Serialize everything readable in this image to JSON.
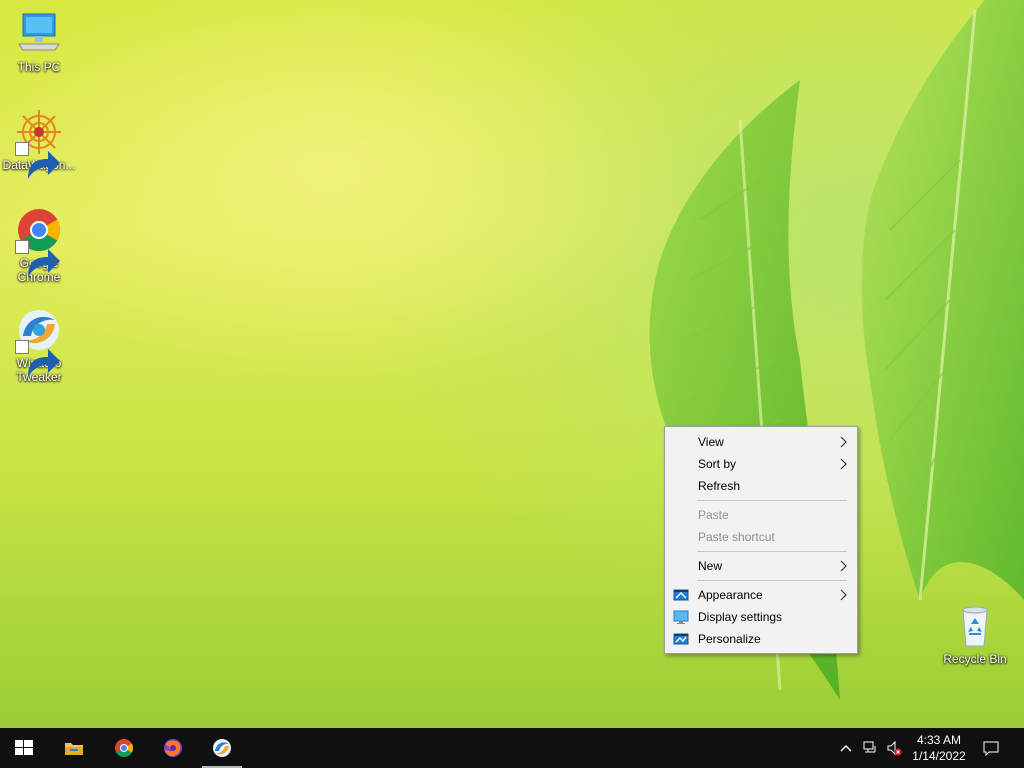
{
  "desktop": {
    "icons": [
      {
        "label": "This PC"
      },
      {
        "label": "DataWagon..."
      },
      {
        "label": "Google Chrome"
      },
      {
        "label": "Winaero Tweaker"
      },
      {
        "label": "Recycle Bin"
      }
    ]
  },
  "context_menu": {
    "items": [
      {
        "label": "View",
        "submenu": true,
        "enabled": true
      },
      {
        "label": "Sort by",
        "submenu": true,
        "enabled": true
      },
      {
        "label": "Refresh",
        "submenu": false,
        "enabled": true
      },
      {
        "label": "Paste",
        "submenu": false,
        "enabled": false
      },
      {
        "label": "Paste shortcut",
        "submenu": false,
        "enabled": false
      },
      {
        "label": "New",
        "submenu": true,
        "enabled": true
      },
      {
        "label": "Appearance",
        "submenu": true,
        "enabled": true,
        "icon": "appearance-icon"
      },
      {
        "label": "Display settings",
        "submenu": false,
        "enabled": true,
        "icon": "display-icon"
      },
      {
        "label": "Personalize",
        "submenu": false,
        "enabled": true,
        "icon": "personalize-icon"
      }
    ]
  },
  "taskbar": {
    "pinned": [
      "start-icon",
      "file-explorer-icon",
      "chrome-icon",
      "firefox-icon",
      "winaero-tweaker-icon"
    ],
    "clock": {
      "time": "4:33 AM",
      "date": "1/14/2022"
    }
  },
  "colors": {
    "taskbar": "#101010",
    "menu_bg": "#f2f2f2",
    "menu_disabled": "#8e8e8e",
    "accent_blue": "#1f7fd6"
  }
}
